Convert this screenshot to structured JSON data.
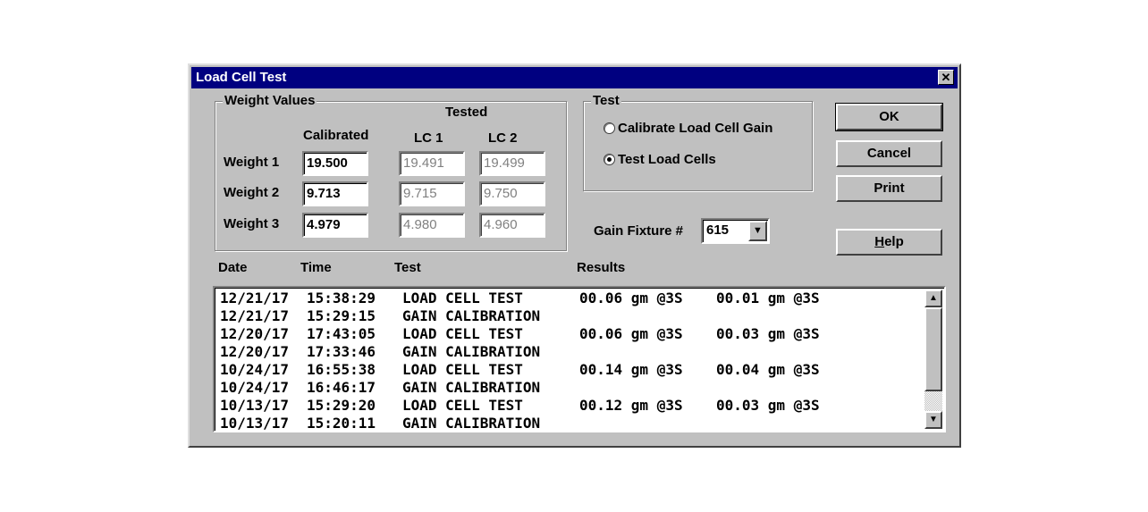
{
  "window": {
    "title": "Load Cell Test"
  },
  "weights": {
    "group_label": "Weight Values",
    "tested_label": "Tested",
    "calibrated_label": "Calibrated",
    "lc1_label": "LC 1",
    "lc2_label": "LC 2",
    "rows": [
      {
        "label": "Weight 1",
        "calibrated": "19.500",
        "lc1": "19.491",
        "lc2": "19.499"
      },
      {
        "label": "Weight 2",
        "calibrated": "9.713",
        "lc1": "9.715",
        "lc2": "9.750"
      },
      {
        "label": "Weight 3",
        "calibrated": "4.979",
        "lc1": "4.980",
        "lc2": "4.960"
      }
    ]
  },
  "test": {
    "group_label": "Test",
    "options": [
      {
        "label": "Calibrate Load Cell Gain",
        "selected": false
      },
      {
        "label": "Test Load Cells",
        "selected": true
      }
    ]
  },
  "buttons": {
    "ok": "OK",
    "cancel": "Cancel",
    "print": "Print",
    "help_prefix": "H",
    "help_rest": "elp"
  },
  "gain_fixture": {
    "label": "Gain Fixture #",
    "value": "615"
  },
  "log": {
    "headers": {
      "date": "Date",
      "time": "Time",
      "test": "Test",
      "results": "Results"
    },
    "rows": [
      {
        "date": "12/21/17",
        "time": "15:38:29",
        "test": "LOAD CELL TEST",
        "r1": "00.06 gm @3S",
        "r2": "00.01 gm @3S"
      },
      {
        "date": "12/21/17",
        "time": "15:29:15",
        "test": "GAIN CALIBRATION",
        "r1": "",
        "r2": ""
      },
      {
        "date": "12/20/17",
        "time": "17:43:05",
        "test": "LOAD CELL TEST",
        "r1": "00.06 gm @3S",
        "r2": "00.03 gm @3S"
      },
      {
        "date": "12/20/17",
        "time": "17:33:46",
        "test": "GAIN CALIBRATION",
        "r1": "",
        "r2": ""
      },
      {
        "date": "10/24/17",
        "time": "16:55:38",
        "test": "LOAD CELL TEST",
        "r1": "00.14 gm @3S",
        "r2": "00.04 gm @3S"
      },
      {
        "date": "10/24/17",
        "time": "16:46:17",
        "test": "GAIN CALIBRATION",
        "r1": "",
        "r2": ""
      },
      {
        "date": "10/13/17",
        "time": "15:29:20",
        "test": "LOAD CELL TEST",
        "r1": "00.12 gm @3S",
        "r2": "00.03 gm @3S"
      },
      {
        "date": "10/13/17",
        "time": "15:20:11",
        "test": "GAIN CALIBRATION",
        "r1": "",
        "r2": ""
      }
    ]
  }
}
